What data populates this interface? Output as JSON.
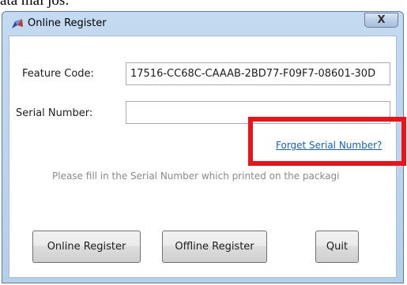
{
  "caption": "ata mai jos:",
  "window": {
    "title": "Online Register",
    "close_symbol": "X"
  },
  "form": {
    "feature_code_label": "Feature Code:",
    "feature_code_value": "17516-CC68C-CAAAB-2BD77-F09F7-08601-30D",
    "serial_number_label": "Serial Number:",
    "serial_number_value": "",
    "forget_link": "Forget Serial Number?",
    "hint": "Please fill in the Serial Number which printed on the packagi"
  },
  "buttons": {
    "online_register": "Online Register",
    "offline_register": "Offline Register",
    "quit": "Quit"
  },
  "annotation": {
    "highlight_color": "#e8141a"
  }
}
